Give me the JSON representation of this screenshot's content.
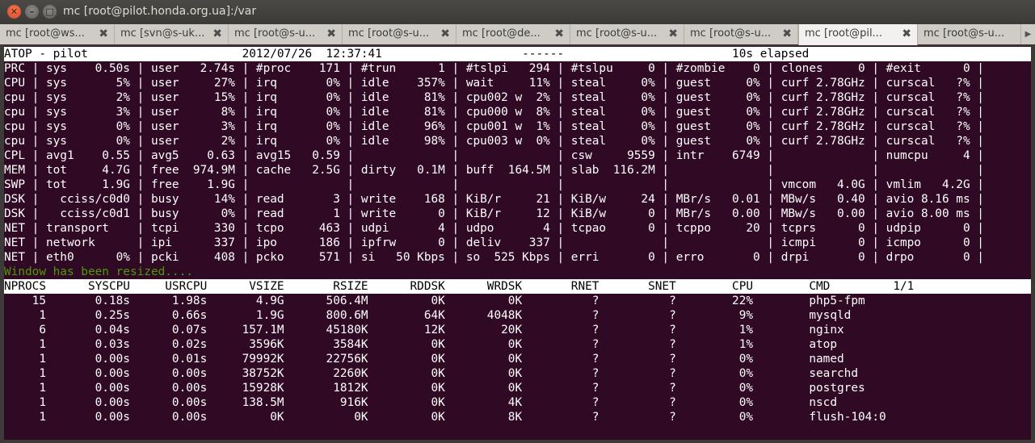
{
  "window": {
    "title": "mc [root@pilot.honda.org.ua]:/var",
    "close_glyph": "✕",
    "minimize_glyph": "–",
    "maximize_glyph": "□"
  },
  "tabs": [
    {
      "label": "mc [root@ws...",
      "active": false
    },
    {
      "label": "mc [svn@s-uk...",
      "active": false
    },
    {
      "label": "mc [root@s-u...",
      "active": false
    },
    {
      "label": "mc [root@s-u...",
      "active": false
    },
    {
      "label": "mc [root@de...",
      "active": false
    },
    {
      "label": "mc [root@s-u...",
      "active": false
    },
    {
      "label": "mc [root@s-u...",
      "active": false
    },
    {
      "label": "mc [root@pil...",
      "active": true
    },
    {
      "label": "mc [root@s-u...",
      "active": false
    }
  ],
  "tab_close_glyph": "✖",
  "tab_scroll_glyph": "▶",
  "terminal": {
    "header_line": "ATOP - pilot                      2012/07/26  12:37:41                    ------                        10s elapsed",
    "system_lines": [
      "PRC | sys    0.50s | user   2.74s | #proc    171 | #trun      1 | #tslpi   294 | #tslpu     0 | #zombie    0 | clones     0 | #exit      0 |",
      "CPU | sys       5% | user     27% | irq       0% | idle    357% | wait     11% | steal     0% | guest     0% | curf 2.78GHz | curscal   ?% |",
      "cpu | sys       2% | user     15% | irq       0% | idle     81% | cpu002 w  2% | steal     0% | guest     0% | curf 2.78GHz | curscal   ?% |",
      "cpu | sys       3% | user      8% | irq       0% | idle     81% | cpu000 w  8% | steal     0% | guest     0% | curf 2.78GHz | curscal   ?% |",
      "cpu | sys       0% | user      3% | irq       0% | idle     96% | cpu001 w  1% | steal     0% | guest     0% | curf 2.78GHz | curscal   ?% |",
      "cpu | sys       0% | user      2% | irq       0% | idle     98% | cpu003 w  0% | steal     0% | guest     0% | curf 2.78GHz | curscal   ?% |",
      "CPL | avg1    0.55 | avg5    0.63 | avg15   0.59 |              |              | csw     9559 | intr    6749 |              | numcpu     4 |",
      "MEM | tot     4.7G | free  974.9M | cache   2.5G | dirty   0.1M | buff  164.5M | slab  116.2M |              |              |              |",
      "SWP | tot     1.9G | free    1.9G |              |              |              |              |              | vmcom   4.0G | vmlim   4.2G |",
      "DSK |   cciss/c0d0 | busy     14% | read       3 | write    168 | KiB/r     21 | KiB/w     24 | MBr/s   0.01 | MBw/s   0.40 | avio 8.16 ms |",
      "DSK |   cciss/c0d1 | busy      0% | read       1 | write      0 | KiB/r     12 | KiB/w      0 | MBr/s   0.00 | MBw/s   0.00 | avio 8.00 ms |",
      "NET | transport    | tcpi     330 | tcpo     463 | udpi       4 | udpo       4 | tcpao      0 | tcppo     20 | tcprs      0 | udpip      0 |",
      "NET | network      | ipi      337 | ipo      186 | ipfrw      0 | deliv    337 |              |              | icmpi      0 | icmpo      0 |",
      "NET | eth0      0% | pcki     408 | pcko     571 | si   50 Kbps | so  525 Kbps | erri       0 | erro       0 | drpi       0 | drpo       0 |"
    ],
    "message": "Window has been resized....",
    "process_header": "NPROCS      SYSCPU     USRCPU      VSIZE       RSIZE      RDDSK      WRDSK       RNET       SNET        CPU        CMD         1/1",
    "process_rows": [
      "    15       0.18s      1.98s       4.9G      506.4M         0K         0K          ?          ?        22%        php5-fpm",
      "     1       0.25s      0.66s       1.9G      800.6M        64K      4048K          ?          ?         9%        mysqld",
      "     6       0.04s      0.07s     157.1M      45180K        12K        20K          ?          ?         1%        nginx",
      "     1       0.03s      0.02s      3596K       3584K         0K         0K          ?          ?         1%        atop",
      "     1       0.00s      0.01s     79992K      22756K         0K         0K          ?          ?         0%        named",
      "     1       0.00s      0.00s     38752K       2260K         0K         0K          ?          ?         0%        searchd",
      "     1       0.00s      0.00s     15928K       1812K         0K         0K          ?          ?         0%        postgres",
      "     1       0.00s      0.00s     138.5M        916K         0K         4K          ?          ?         0%        nscd",
      "     1       0.00s      0.00s         0K          0K         0K         8K          ?          ?         0%        flush-104:0"
    ]
  }
}
